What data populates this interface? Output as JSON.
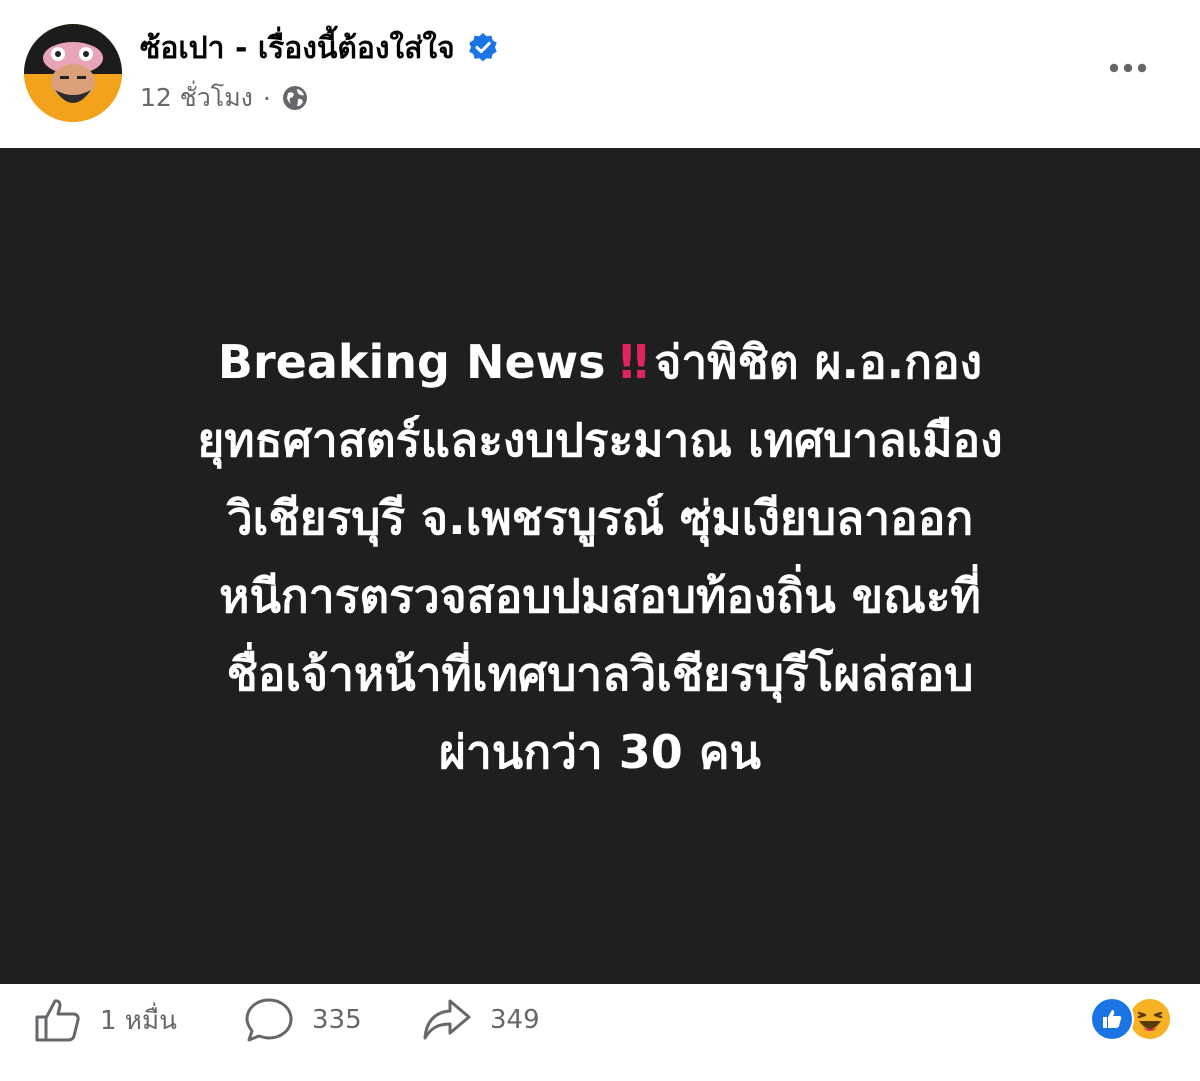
{
  "post": {
    "author": "ซ้อเปา - เรื่องนี้ต้องใส่ใจ",
    "timestamp": "12 ชั่วโมง",
    "separator": "·",
    "privacy_icon": "globe-icon",
    "verified_icon": "verified-badge-icon",
    "more_icon": "more-options-icon"
  },
  "content": {
    "background_color": "#1f1f1f",
    "text_color": "#ffffff",
    "lead": "Breaking News",
    "emphasis": "‼",
    "lines": [
      "จ่าพิชิต ผ.อ.กอง",
      "ยุทธศาสตร์และงบประมาณ เทศบาลเมือง",
      "วิเชียรบุรี จ.เพชรบูรณ์ ซุ่มเงียบลาออก",
      "หนีการตรวจสอบปมสอบท้องถิ่น ขณะที่",
      "ชื่อเจ้าหน้าที่เทศบาลวิเชียรบุรีโผล่สอบ",
      "ผ่านกว่า 30 คน"
    ]
  },
  "actions": {
    "like_count": "1 หมื่น",
    "comment_count": "335",
    "share_count": "349",
    "like_icon": "thumbs-up-icon",
    "comment_icon": "comment-bubble-icon",
    "share_icon": "share-arrow-icon"
  },
  "reactions": {
    "types": [
      "like",
      "haha"
    ],
    "like_color": "#1b74e4",
    "haha_color": "#f7b125"
  }
}
